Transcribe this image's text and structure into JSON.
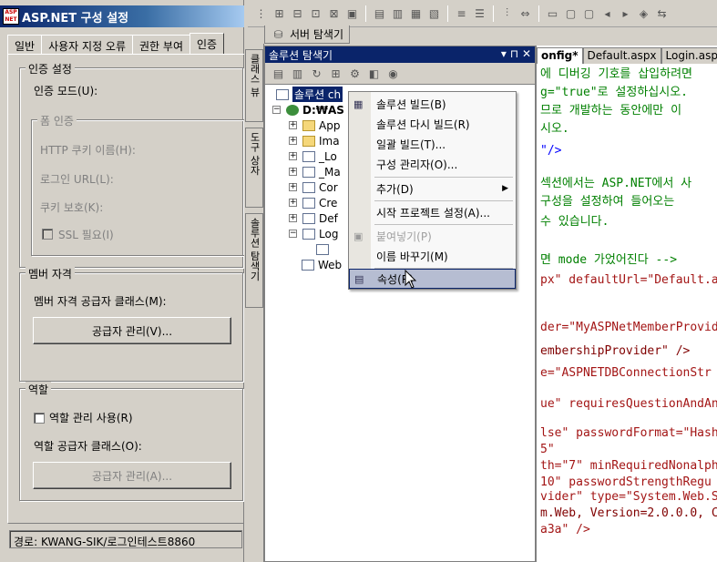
{
  "config": {
    "title": "ASP.NET 구성 설정",
    "logo_text": "ASP.NET",
    "tabs": [
      "일반",
      "사용자 지정 오류",
      "권한 부여",
      "인증"
    ],
    "auth_group": {
      "label": "인증 설정",
      "mode_label": "인증 모드(U):",
      "forms_group": {
        "label": "폼 인증",
        "cookie_name": "HTTP 쿠키 이름(H):",
        "login_url": "로그인 URL(L):",
        "cookie_protect": "쿠키 보호(K):",
        "ssl_required": "SSL 필요(I)"
      }
    },
    "membership_group": {
      "label": "멤버 자격",
      "provider_class": "멤버 자격 공급자 클래스(M):",
      "manage_button": "공급자 관리(V)..."
    },
    "roles_group": {
      "label": "역할",
      "enable_roles": "역할 관리 사용(R)",
      "provider_class": "역할 공급자 클래스(O):",
      "manage_button": "공급자 관리(A)..."
    },
    "status_path": "경로: KWANG-SIK/로그인테스트8860"
  },
  "vs": {
    "server_explorer_tab": "서버 탐색기",
    "side_tabs": [
      "클래스 뷰",
      "도구 상자",
      "솔루션 탐색기"
    ],
    "solution_explorer": {
      "title": "솔루션 탐색기",
      "title_buttons": "▾ ⊓ ✕",
      "tree": [
        {
          "label": "솔루션 ch",
          "selected": true
        },
        {
          "label": "D:₩AS"
        },
        {
          "label": "App"
        },
        {
          "label": "Ima"
        },
        {
          "label": "_Lo"
        },
        {
          "label": "_Ma"
        },
        {
          "label": "Cor"
        },
        {
          "label": "Cre"
        },
        {
          "label": "Def"
        },
        {
          "label": "Log"
        },
        {
          "label": ""
        },
        {
          "label": "Web"
        }
      ]
    },
    "context_menu": {
      "items": [
        {
          "label": "솔루션 빌드(B)",
          "icon": "build-icon"
        },
        {
          "label": "솔루션 다시 빌드(R)"
        },
        {
          "label": "일괄 빌드(T)..."
        },
        {
          "label": "구성 관리자(O)..."
        },
        {
          "label": "추가(D)",
          "submenu": true
        },
        {
          "label": "시작 프로젝트 설정(A)..."
        },
        {
          "label": "붙여넣기(P)",
          "disabled": true,
          "icon": "paste-icon"
        },
        {
          "label": "이름 바꾸기(M)"
        },
        {
          "label": "속성(R)",
          "selected": true,
          "icon": "properties-icon"
        }
      ]
    },
    "editor": {
      "tabs": [
        "onfig*",
        "Default.aspx",
        "Login.asp"
      ],
      "lines": [
        {
          "text": "에 디버깅 기호를 삽입하려면",
          "cls": "c-green"
        },
        {
          "text": "g=\"true\"로 설정하십시오.",
          "cls": "c-green"
        },
        {
          "text": "므로 개발하는 동안에만 이",
          "cls": "c-green"
        },
        {
          "text": "시오.",
          "cls": "c-green"
        },
        {
          "text": "\"/>",
          "cls": "c-blue"
        },
        {
          "text": "섹션에서는 ASP.NET에서 사",
          "cls": "c-green"
        },
        {
          "text": "구성을 설정하여 들어오는",
          "cls": "c-green"
        },
        {
          "text": "수 있습니다.",
          "cls": "c-green"
        },
        {
          "text": "면 mode 가었어진다 -->",
          "cls": "c-green"
        },
        {
          "text": "px\" defaultUrl=\"Default.a",
          "cls": "c-red"
        },
        {
          "text": "der=\"MyASPNetMemberProvid",
          "cls": "c-red"
        },
        {
          "text": "embershipProvider\" />",
          "cls": "c-maroon"
        },
        {
          "text": "e=\"ASPNETDBConnectionStr",
          "cls": "c-red"
        },
        {
          "text": "ue\" requiresQuestionAndAn",
          "cls": "c-red"
        },
        {
          "text": "lse\" passwordFormat=\"Hash",
          "cls": "c-red"
        },
        {
          "text": "5\"",
          "cls": "c-red"
        },
        {
          "text": "th=\"7\" minRequiredNonalph",
          "cls": "c-red"
        },
        {
          "text": "10\" passwordStrengthRegu",
          "cls": "c-red"
        },
        {
          "text": "vider\" type=\"System.Web.S",
          "cls": "c-red"
        },
        {
          "text": "m.Web, Version=2.0.0.0, C",
          "cls": "c-maroon"
        },
        {
          "text": "a3a\" />",
          "cls": "c-red"
        }
      ]
    }
  }
}
